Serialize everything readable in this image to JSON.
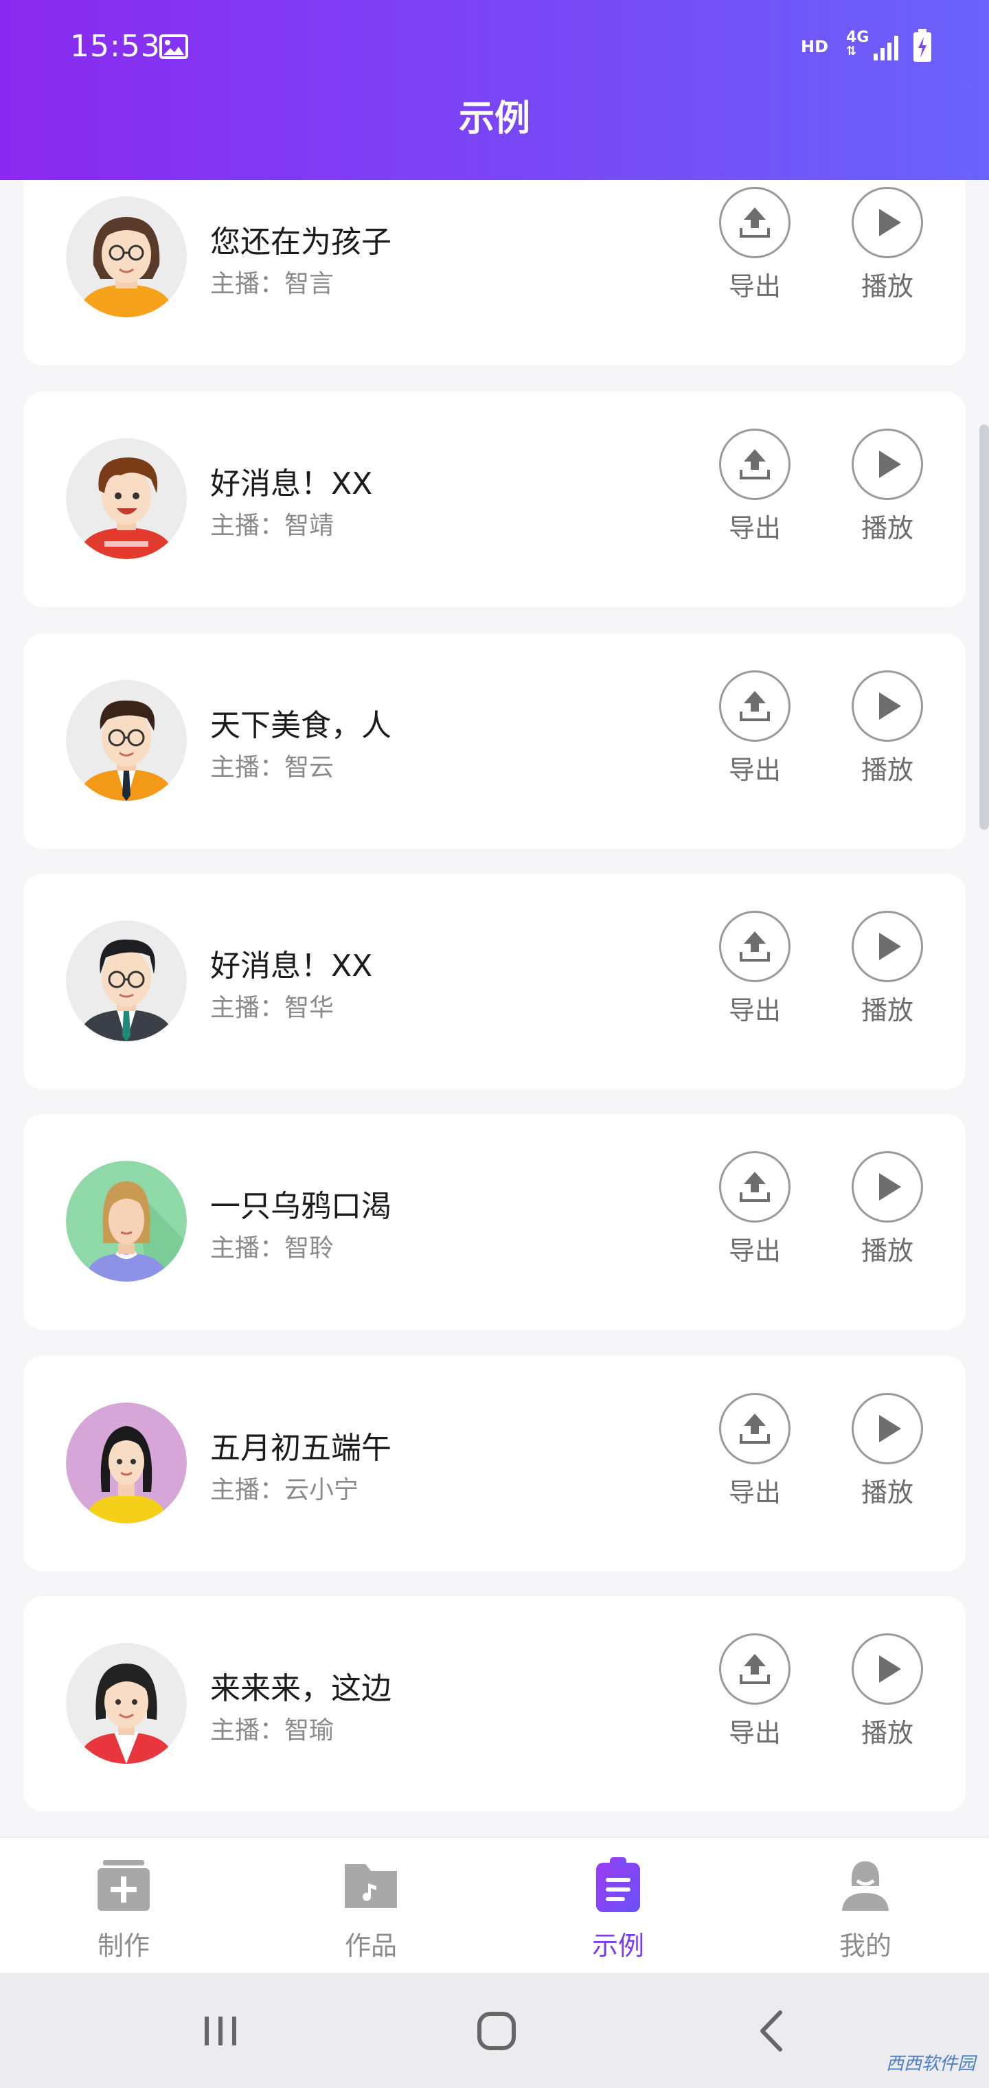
{
  "status_bar": {
    "time": "15:53",
    "hd": "HD",
    "network": "4G"
  },
  "header": {
    "title": "示例"
  },
  "items": [
    {
      "title": "您还在为孩子",
      "host": "主播：智言",
      "export_label": "导出",
      "play_label": "播放"
    },
    {
      "title": "好消息！XX",
      "host": "主播：智靖",
      "export_label": "导出",
      "play_label": "播放"
    },
    {
      "title": "天下美食，人",
      "host": "主播：智云",
      "export_label": "导出",
      "play_label": "播放"
    },
    {
      "title": "好消息！XX",
      "host": "主播：智华",
      "export_label": "导出",
      "play_label": "播放"
    },
    {
      "title": "一只乌鸦口渴",
      "host": "主播：智聆",
      "export_label": "导出",
      "play_label": "播放"
    },
    {
      "title": "五月初五端午",
      "host": "主播：云小宁",
      "export_label": "导出",
      "play_label": "播放"
    },
    {
      "title": "来来来，这边",
      "host": "主播：智瑜",
      "export_label": "导出",
      "play_label": "播放"
    }
  ],
  "bottom_nav": [
    {
      "label": "制作",
      "icon": "create-icon",
      "active": false
    },
    {
      "label": "作品",
      "icon": "works-folder-icon",
      "active": false
    },
    {
      "label": "示例",
      "icon": "examples-clipboard-icon",
      "active": true
    },
    {
      "label": "我的",
      "icon": "profile-icon",
      "active": false
    }
  ],
  "watermark": "西西软件园",
  "colors": {
    "accent": "#7a3cf0",
    "header_start": "#8a2af0",
    "header_end": "#6a62fb",
    "inactive": "#8c8c8c"
  }
}
